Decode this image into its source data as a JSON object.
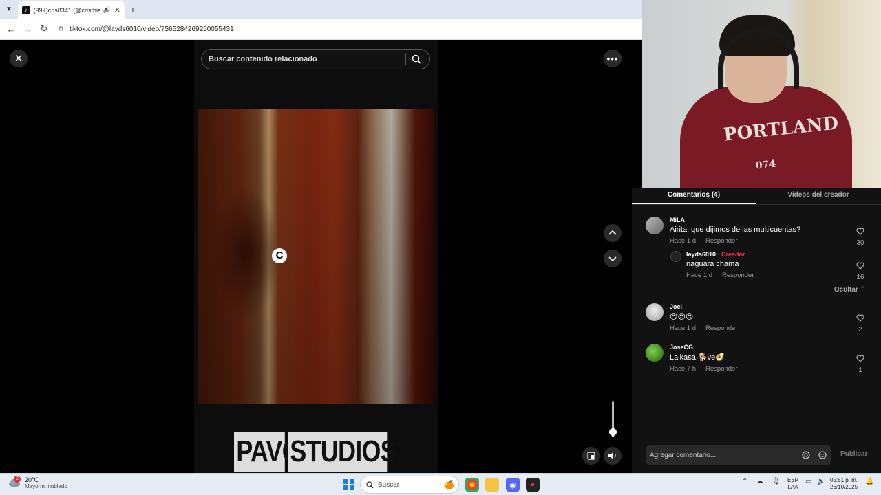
{
  "browser": {
    "tab_title": "(99+)cris8341 (@cristhian5",
    "url": "tiktok.com/@layds6010/video/7565284269250055431"
  },
  "video": {
    "search_placeholder": "Buscar contenido relacionado",
    "overlay_letter": "C",
    "logo_left": "PAVO",
    "logo_right": "STUDIOS",
    "volume_level": 0.15
  },
  "webcam": {
    "shirt_text": "PORTLAND",
    "shirt_number": "074"
  },
  "comments": {
    "tab_comments": "Comentarios (4)",
    "tab_creator_videos": "Videos del creador",
    "items": [
      {
        "user": "MiLA",
        "text": "Airita, que dijimos de las multicuentas?",
        "time": "Hace 1 d",
        "reply": "Responder",
        "likes": "30"
      },
      {
        "user": "layds6010",
        "creator_sep": " · ",
        "creator_label": "Creador",
        "text": "naguara chama",
        "time": "Hace 1 d",
        "reply": "Responder",
        "likes": "16"
      },
      {
        "user": "Joel",
        "text": "😍😍😍",
        "time": "Hace 1 d",
        "reply": "Responder",
        "likes": "2"
      },
      {
        "user": "JoseCG",
        "text": "Laikasa 🐕ve🥑",
        "time": "Hace 7 h",
        "reply": "Responder",
        "likes": "1"
      }
    ],
    "hide_label": "Ocultar",
    "input_placeholder": "Agregar comentario...",
    "publish_label": "Publicar"
  },
  "taskbar": {
    "temperature": "20°C",
    "weather": "Mayorm. nublado",
    "weather_badge": "2",
    "search_label": "Buscar",
    "lang_line1": "ESP",
    "lang_line2": "LAA",
    "time": "05:51 p. m.",
    "date": "26/10/2025"
  }
}
